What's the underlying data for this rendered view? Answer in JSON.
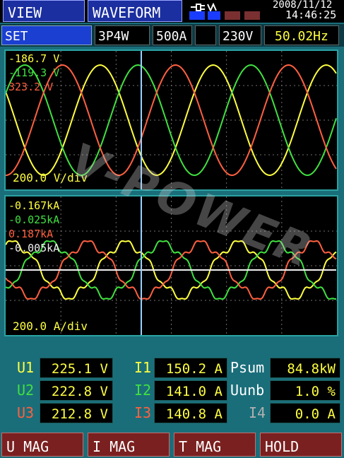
{
  "tabs": {
    "view": "VIEW",
    "waveform": "WAVEFORM"
  },
  "status": {
    "date": "2008/11/12",
    "time": "14:46:25",
    "plug_icon": "power-plug-icon"
  },
  "info": {
    "set": "SET",
    "wiring": "3P4W",
    "clamp": "500A",
    "blank": "",
    "voltage": "230V",
    "frequency": "50.02Hz"
  },
  "voltage_panel": {
    "cursor_values": [
      "-186.7 V",
      "-119.3 V",
      "323.2 V"
    ],
    "scale": "200.0 V/div"
  },
  "current_panel": {
    "cursor_values": [
      "-0.167kA",
      "-0.025kA",
      "0.187kA",
      "-0.005kA"
    ],
    "scale": "200.0 A/div"
  },
  "colors": {
    "yellow": "#ffff40",
    "green": "#40e040",
    "red": "#ff6040",
    "white": "#f0f0f0"
  },
  "measurements": {
    "col1": [
      {
        "label": "U1",
        "value": "225.1 V",
        "color": "#ffff40"
      },
      {
        "label": "U2",
        "value": "222.8 V",
        "color": "#40e040"
      },
      {
        "label": "U3",
        "value": "212.8 V",
        "color": "#ff6040"
      }
    ],
    "col2": [
      {
        "label": "I1",
        "value": "150.2 A",
        "color": "#ffff40"
      },
      {
        "label": "I2",
        "value": "141.0 A",
        "color": "#40e040"
      },
      {
        "label": "I3",
        "value": "140.8 A",
        "color": "#ff6040"
      }
    ],
    "col3": [
      {
        "label": "Psum",
        "value": "84.8kW"
      },
      {
        "label": "Uunb",
        "value": "1.0 %"
      },
      {
        "label": "I4",
        "value": "0.0 A"
      }
    ]
  },
  "function_keys": [
    "U MAG",
    "I MAG",
    "T MAG",
    "HOLD"
  ],
  "watermark": "V-POWER"
}
